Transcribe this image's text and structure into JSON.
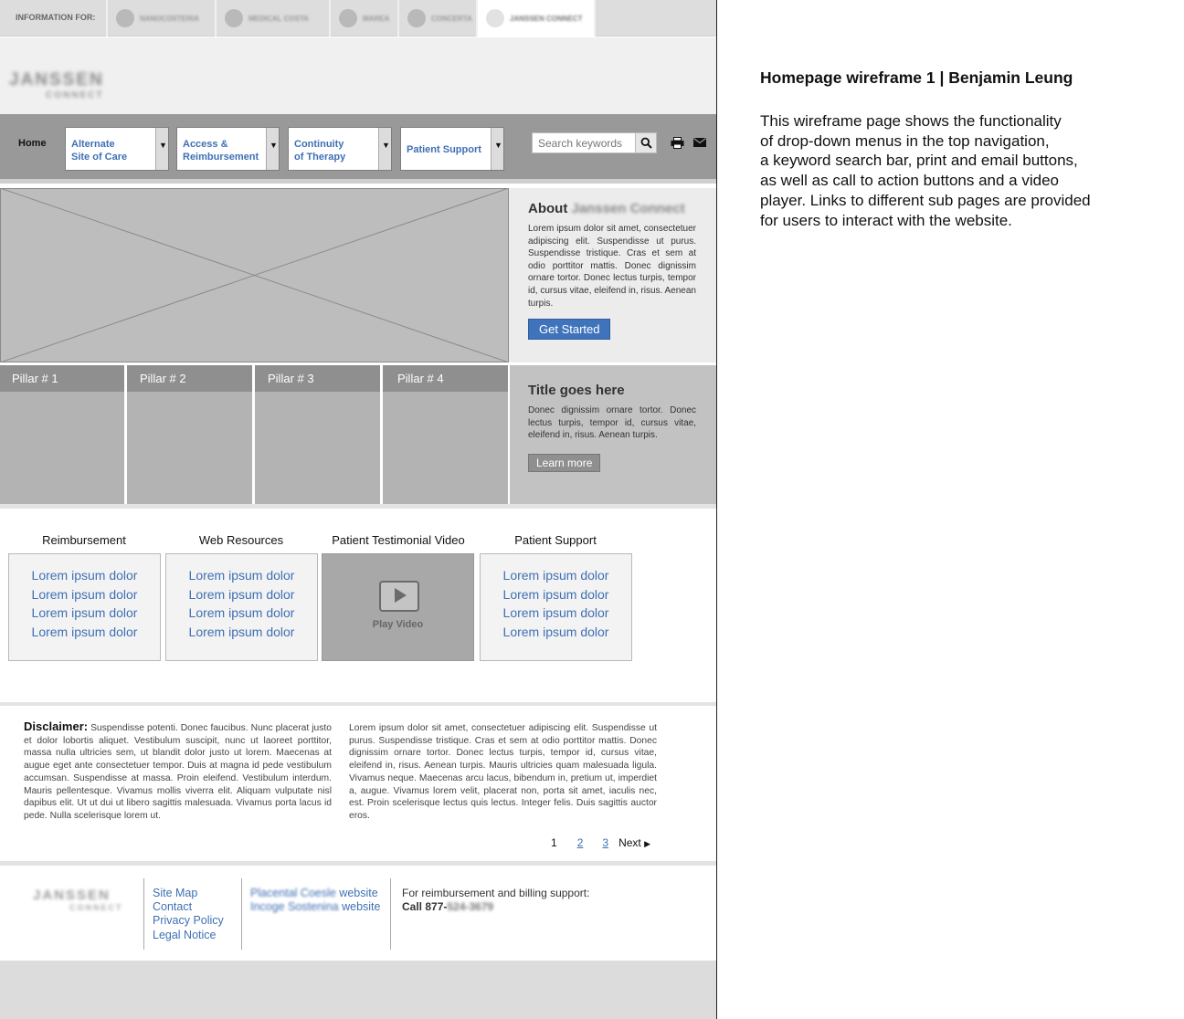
{
  "infobar": {
    "label": "INFORMATION FOR:",
    "tabs": [
      "NANOCOSTERIA",
      "MEDICAL COSTA",
      "MAREA",
      "CONCERTA",
      "JANSSEN CONNECT"
    ]
  },
  "brand": {
    "logo_line1": "JANSSEN",
    "logo_line2": "CONNECT"
  },
  "nav": {
    "home": "Home",
    "dropdowns": [
      {
        "line1": "Alternate",
        "line2": "Site of Care"
      },
      {
        "line1": "Access &",
        "line2": "Reimbursement"
      },
      {
        "line1": "Continuity",
        "line2": "of Therapy"
      },
      {
        "line1": "Patient Support",
        "line2": ""
      }
    ],
    "search_placeholder": "Search keywords"
  },
  "about": {
    "heading": "About",
    "heading_brand": "Janssen Connect",
    "text": "Lorem ipsum dolor sit amet, consectetuer adipiscing elit. Suspendisse ut purus. Suspendisse tristique. Cras et sem at odio porttitor mattis. Donec dignissim ornare tortor. Donec lectus turpis, tempor id, cursus vitae, eleifend in, risus. Aenean turpis.",
    "button": "Get Started"
  },
  "pillars": [
    "Pillar # 1",
    "Pillar # 2",
    "Pillar # 3",
    "Pillar # 4"
  ],
  "promo": {
    "heading": "Title goes here",
    "text": "Donec dignissim ornare tortor. Donec lectus turpis, tempor id, cursus vitae, eleifend in, risus. Aenean turpis.",
    "button": "Learn more"
  },
  "resources": {
    "reimbursement": {
      "title": "Reimbursement",
      "links": [
        "Lorem ipsum dolor",
        "Lorem ipsum dolor",
        "Lorem ipsum dolor",
        "Lorem ipsum dolor"
      ]
    },
    "web": {
      "title": "Web Resources",
      "links": [
        "Lorem ipsum dolor",
        "Lorem ipsum dolor",
        "Lorem ipsum dolor",
        "Lorem ipsum dolor"
      ]
    },
    "video": {
      "title": "Patient Testimonial Video",
      "label": "Play Video"
    },
    "support": {
      "title": "Patient Support",
      "links": [
        "Lorem ipsum dolor",
        "Lorem ipsum dolor",
        "Lorem ipsum dolor",
        "Lorem ipsum dolor"
      ]
    }
  },
  "disclaimer": {
    "label": "Disclaimer:",
    "col1": "Suspendisse potenti. Donec faucibus. Nunc placerat justo et dolor lobortis aliquet. Vestibulum suscipit, nunc ut laoreet porttitor, massa nulla ultricies sem, ut blandit dolor justo ut lorem. Maecenas at augue eget ante consectetuer tempor. Duis at magna id pede vestibulum accumsan. Suspendisse at massa. Proin eleifend. Vestibulum interdum. Mauris pellentesque. Vivamus mollis viverra elit. Aliquam vulputate nisl dapibus elit. Ut ut dui ut libero sagittis malesuada. Vivamus porta lacus id pede. Nulla scelerisque lorem ut.",
    "col2": "Lorem ipsum dolor sit amet, consectetuer adipiscing elit. Suspendisse ut purus. Suspendisse tristique. Cras et sem at odio porttitor mattis. Donec dignissim ornare tortor. Donec lectus turpis, tempor id, cursus vitae, eleifend in, risus. Aenean turpis. Mauris ultricies quam malesuada ligula. Vivamus neque. Maecenas arcu lacus, bibendum in, pretium ut, imperdiet a, augue. Vivamus lorem velit, placerat non, porta sit amet, iaculis nec, est. Proin scelerisque lectus quis lectus. Integer felis. Duis sagittis auctor eros."
  },
  "pager": {
    "current": "1",
    "p2": "2",
    "p3": "3",
    "next": "Next"
  },
  "footer": {
    "logo_line1": "JANSSEN",
    "logo_line2": "CONNECT",
    "links": [
      "Site Map",
      "Contact",
      "Privacy Policy",
      "Legal Notice"
    ],
    "site1_name": "Placental Coesle",
    "site2_name": "Incoge Sostenina",
    "site_suffix": "website",
    "support_text": "For reimbursement and billing support:",
    "call_label": "Call 877-",
    "call_number": "524-3679"
  },
  "annotation": {
    "title": "Homepage wireframe 1 | Benjamin Leung",
    "body_lines": [
      "This wireframe page shows the functionality",
      "of drop-down menus in the top navigation,",
      "a keyword search bar, print and email buttons,",
      "as well as call to action buttons and a video",
      "player. Links to different sub pages are provided",
      "for users to interact with the website."
    ]
  },
  "icons": [
    "search-icon",
    "print-icon",
    "email-icon",
    "play-icon",
    "chevron-down-icon",
    "next-arrow-icon"
  ],
  "colors": {
    "link_blue": "#3f70b4",
    "cta_blue": "#3f74bd",
    "nav_grey": "#999999"
  }
}
